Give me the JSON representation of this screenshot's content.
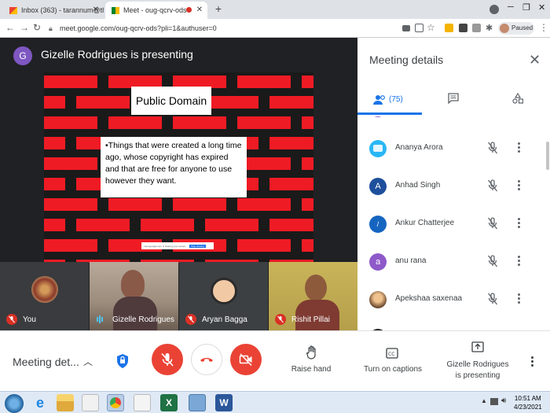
{
  "browser": {
    "tabs": [
      {
        "title": "Inbox (363) - tarannum@theindi"
      },
      {
        "title": "Meet - oug-qcrv-ods"
      }
    ],
    "url": "meet.google.com/oug-qcrv-ods?pli=1&authuser=0",
    "profile_status": "Paused"
  },
  "stage": {
    "presenter_initial": "G",
    "presenter_title": "Gizelle Rodrigues is presenting",
    "slide": {
      "title": "Public Domain",
      "bullet": "•Things that were created a long time ago, whose copyright has expired and that are free for anyone to use however they want."
    }
  },
  "tiles": [
    {
      "name": "You",
      "muted": true
    },
    {
      "name": "Gizelle Rodrigues",
      "muted": false
    },
    {
      "name": "Aryan Bagga",
      "muted": true
    },
    {
      "name": "Rishit Pillai",
      "muted": true
    }
  ],
  "panel": {
    "title": "Meeting details",
    "people_count": "(75)",
    "people": [
      {
        "name": "Ananya Arora",
        "initial": "",
        "color": "#29b6f6"
      },
      {
        "name": "Anhad Singh",
        "initial": "A",
        "color": "#1e4f9c"
      },
      {
        "name": "Ankur Chatterjee",
        "initial": "",
        "color": "#1565c0"
      },
      {
        "name": "anu rana",
        "initial": "a",
        "color": "#8e59c9"
      },
      {
        "name": "Apekshaa saxenaa",
        "initial": "",
        "color": "#d4a15f"
      }
    ]
  },
  "bottombar": {
    "meeting_details": "Meeting det...",
    "raise_hand": "Raise hand",
    "captions": "Turn on captions",
    "presenting": "Gizelle Rodrigues\nis presenting"
  },
  "taskbar": {
    "time": "10:51 AM",
    "date": "4/23/2021"
  }
}
